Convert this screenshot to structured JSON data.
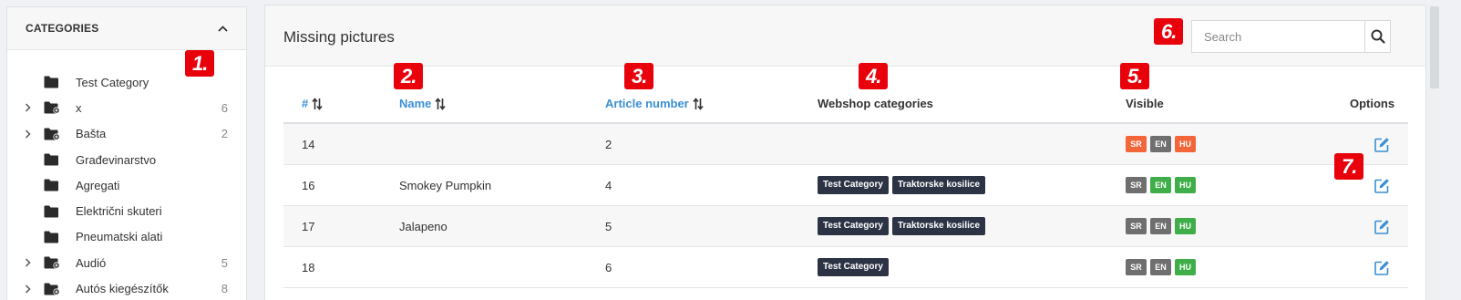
{
  "sidebar": {
    "title": "CATEGORIES",
    "items": [
      {
        "label": "Test Category",
        "count": "",
        "expandable": false
      },
      {
        "label": "x",
        "count": "6",
        "expandable": true
      },
      {
        "label": "Bašta",
        "count": "2",
        "expandable": true
      },
      {
        "label": "Građevinarstvo",
        "count": "",
        "expandable": false
      },
      {
        "label": "Agregati",
        "count": "",
        "expandable": false
      },
      {
        "label": "Električni skuteri",
        "count": "",
        "expandable": false
      },
      {
        "label": "Pneumatski alati",
        "count": "",
        "expandable": false
      },
      {
        "label": "Audió",
        "count": "5",
        "expandable": true
      },
      {
        "label": "Autós kiegészítők",
        "count": "8",
        "expandable": true
      }
    ]
  },
  "main": {
    "title": "Missing pictures",
    "search": {
      "placeholder": "Search",
      "value": ""
    },
    "columns": {
      "id": "#",
      "name": "Name",
      "article": "Article number",
      "cats": "Webshop categories",
      "visible": "Visible",
      "options": "Options"
    },
    "rows": [
      {
        "id": "14",
        "name": "",
        "article": "2",
        "cats": [],
        "vis": [
          {
            "lang": "SR",
            "state": "orange"
          },
          {
            "lang": "EN",
            "state": "grey"
          },
          {
            "lang": "HU",
            "state": "orange"
          }
        ]
      },
      {
        "id": "16",
        "name": "Smokey Pumpkin",
        "article": "4",
        "cats": [
          "Test Category",
          "Traktorske kosilice"
        ],
        "vis": [
          {
            "lang": "SR",
            "state": "grey"
          },
          {
            "lang": "EN",
            "state": "green"
          },
          {
            "lang": "HU",
            "state": "green"
          }
        ]
      },
      {
        "id": "17",
        "name": "Jalapeno",
        "article": "5",
        "cats": [
          "Test Category",
          "Traktorske kosilice"
        ],
        "vis": [
          {
            "lang": "SR",
            "state": "grey"
          },
          {
            "lang": "EN",
            "state": "grey"
          },
          {
            "lang": "HU",
            "state": "green"
          }
        ]
      },
      {
        "id": "18",
        "name": "",
        "article": "6",
        "cats": [
          "Test Category"
        ],
        "vis": [
          {
            "lang": "SR",
            "state": "grey"
          },
          {
            "lang": "EN",
            "state": "grey"
          },
          {
            "lang": "HU",
            "state": "green"
          }
        ]
      }
    ]
  },
  "annotations": [
    "1.",
    "2.",
    "3.",
    "4.",
    "5.",
    "6.",
    "7."
  ],
  "colors": {
    "accent": "#3a8fd6",
    "marker": "#e8000b",
    "tag": "#2c3345",
    "orange": "#f2663a",
    "grey": "#6f6f6f",
    "green": "#3fae49"
  }
}
